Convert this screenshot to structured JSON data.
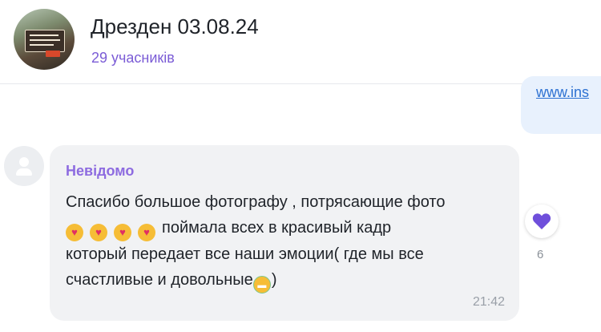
{
  "header": {
    "title": "Дрезден 03.08.24",
    "members": "29 учасників"
  },
  "outgoing": {
    "link_text": "www.ins"
  },
  "message": {
    "sender": "Невідомо",
    "line1": "Спасибо большое фотографу , потрясающие фото",
    "line2": "поймала всех в красивый кадр",
    "line3": "который передает все наши эмоции( где мы все",
    "line4": "счастливые и довольные",
    "line4_tail": ")",
    "time": "21:42",
    "emojis": [
      "smiling-face-with-heart-eyes",
      "smiling-face-with-heart-eyes",
      "smiling-face-with-heart-eyes",
      "smiling-face-with-heart-eyes"
    ],
    "end_emoji": "grinning-face-icon"
  },
  "reaction": {
    "icon": "purple-heart-icon",
    "color": "#6f4fdb",
    "count": "6"
  },
  "colors": {
    "accent": "#7b5cd6",
    "sender": "#8d6be0",
    "link": "#2e72d2",
    "bubble": "#f1f2f4"
  }
}
